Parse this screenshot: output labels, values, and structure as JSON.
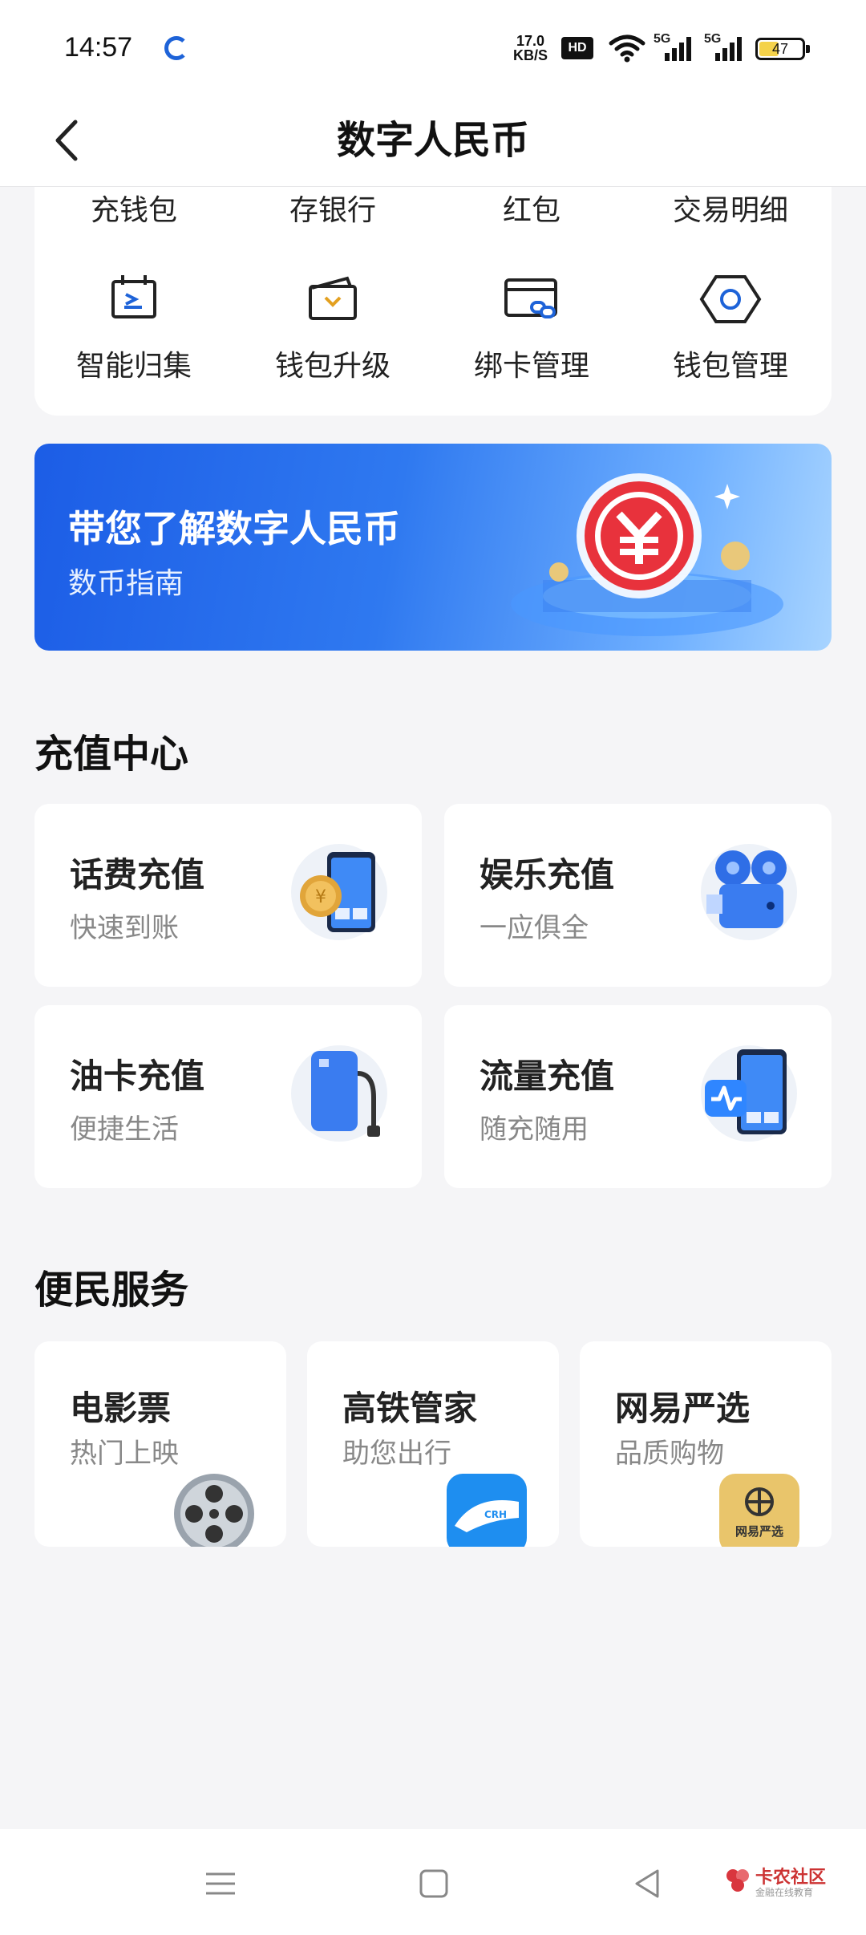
{
  "status_bar": {
    "time": "14:57",
    "net_speed_value": "17.0",
    "net_speed_unit": "KB/S",
    "hd_label": "HD",
    "signal1": "5G",
    "signal2": "5G",
    "battery": "47",
    "battery_fraction": 0.47,
    "battery_color": "#f4d24a"
  },
  "nav": {
    "title": "数字人民币",
    "back_icon": "chevron-left-icon"
  },
  "quick_actions": {
    "top_row": [
      "充钱包",
      "存银行",
      "红包",
      "交易明细"
    ],
    "items": [
      {
        "label": "智能归集",
        "icon": "calendar-arrow-icon"
      },
      {
        "label": "钱包升级",
        "icon": "wallet-upgrade-icon"
      },
      {
        "label": "绑卡管理",
        "icon": "card-link-icon"
      },
      {
        "label": "钱包管理",
        "icon": "hexagon-settings-icon"
      }
    ]
  },
  "banner": {
    "title": "带您了解数字人民币",
    "subtitle": "数币指南",
    "icon": "digital-yuan-coin-icon"
  },
  "recharge_center": {
    "title": "充值中心",
    "tiles": [
      {
        "title": "话费充值",
        "subtitle": "快速到账",
        "icon": "phone-coin-icon"
      },
      {
        "title": "娱乐充值",
        "subtitle": "一应俱全",
        "icon": "film-projector-icon"
      },
      {
        "title": "油卡充值",
        "subtitle": "便捷生活",
        "icon": "fuel-card-icon"
      },
      {
        "title": "流量充值",
        "subtitle": "随充随用",
        "icon": "phone-data-icon"
      }
    ]
  },
  "services": {
    "title": "便民服务",
    "tiles": [
      {
        "title": "电影票",
        "subtitle": "热门上映",
        "icon": "film-reel-icon"
      },
      {
        "title": "高铁管家",
        "subtitle": "助您出行",
        "icon": "train-app-icon",
        "badge": "CRH"
      },
      {
        "title": "网易严选",
        "subtitle": "品质购物",
        "icon": "netease-yanxuan-icon",
        "badge": "网易严选"
      }
    ]
  },
  "bottom_nav": {
    "menu_icon": "menu-icon",
    "home_icon": "home-square-icon",
    "back_icon": "back-triangle-icon"
  },
  "watermark": {
    "title": "卡农社区",
    "subtitle": "金融在线教育"
  },
  "colors": {
    "accent": "#1e63d8",
    "banner_start": "#1c5de6",
    "banner_end": "#a8d4ff",
    "background": "#f5f5f7"
  }
}
